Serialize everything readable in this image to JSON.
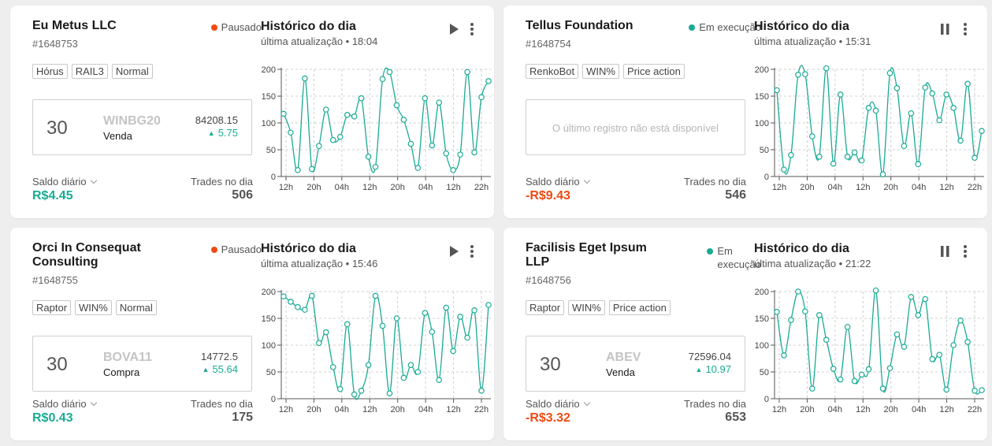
{
  "cards": [
    {
      "name_lines": [
        "Eu Metus LLC"
      ],
      "code": "#1648753",
      "status_lines": [
        "Pausado"
      ],
      "status_color": "#f04a14",
      "tags": [
        "Hórus",
        "RAIL3",
        "Normal"
      ],
      "order": {
        "qty": "30",
        "symbol": "WINBG20",
        "side": "Venda",
        "price": "84208.15",
        "change": "5.75"
      },
      "empty_text": "",
      "saldo_label": "Saldo diário",
      "saldo_value": "R$4.45",
      "saldo_sign": "pos",
      "trades_label": "Trades no dia",
      "trades_value": "506",
      "history_title": "Histórico do dia",
      "history_updated": "última atualização • 18:04",
      "action_icon": "play-icon"
    },
    {
      "name_lines": [
        "Tellus Foundation"
      ],
      "code": "#1648754",
      "status_lines": [
        "Em execução"
      ],
      "status_color": "#1aab95",
      "tags": [
        "RenkoBot",
        "WIN%",
        "Price action"
      ],
      "order": null,
      "empty_text": "O último registro não está disponível",
      "saldo_label": "Saldo diário",
      "saldo_value": "-R$9.43",
      "saldo_sign": "neg",
      "trades_label": "Trades no dia",
      "trades_value": "546",
      "history_title": "Histórico do dia",
      "history_updated": "última atualização • 15:31",
      "action_icon": "pause-icon"
    },
    {
      "name_lines": [
        "Orci In Consequat",
        "Consulting"
      ],
      "code": "#1648755",
      "status_lines": [
        "Pausado"
      ],
      "status_color": "#f04a14",
      "tags": [
        "Raptor",
        "WIN%",
        "Normal"
      ],
      "order": {
        "qty": "30",
        "symbol": "BOVA11",
        "side": "Compra",
        "price": "14772.5",
        "change": "55.64"
      },
      "empty_text": "",
      "saldo_label": "Saldo diário",
      "saldo_value": "R$0.43",
      "saldo_sign": "pos",
      "trades_label": "Trades no dia",
      "trades_value": "175",
      "history_title": "Histórico do dia",
      "history_updated": "última atualização • 15:46",
      "action_icon": "play-icon"
    },
    {
      "name_lines": [
        "Facilisis Eget Ipsum",
        "LLP"
      ],
      "code": "#1648756",
      "status_lines": [
        "Em",
        "execução"
      ],
      "status_color": "#1aab95",
      "tags": [
        "Raptor",
        "WIN%",
        "Price action"
      ],
      "order": {
        "qty": "30",
        "symbol": "ABEV",
        "side": "Venda",
        "price": "72596.04",
        "change": "10.97"
      },
      "empty_text": "",
      "saldo_label": "Saldo diário",
      "saldo_value": "-R$3.32",
      "saldo_sign": "neg",
      "trades_label": "Trades no dia",
      "trades_value": "653",
      "history_title": "Histórico do dia",
      "history_updated": "última atualização • 21:22",
      "action_icon": "pause-icon"
    }
  ],
  "chart_data": [
    {
      "type": "line",
      "xticks": [
        "12h",
        "20h",
        "04h",
        "12h",
        "20h",
        "04h",
        "12h",
        "22h"
      ],
      "yticks": [
        0,
        50,
        100,
        150,
        200
      ],
      "ylim": [
        0,
        200
      ],
      "grid": true,
      "color": "#1aab95",
      "values": [
        117,
        82,
        12,
        183,
        14,
        57,
        125,
        68,
        74,
        115,
        112,
        146,
        37,
        18,
        182,
        195,
        133,
        106,
        61,
        16,
        146,
        58,
        138,
        43,
        12,
        41,
        195,
        45,
        148,
        178
      ]
    },
    {
      "type": "line",
      "xticks": [
        "12h",
        "20h",
        "04h",
        "12h",
        "20h",
        "04h",
        "12h",
        "22h"
      ],
      "yticks": [
        0,
        50,
        100,
        150,
        200
      ],
      "ylim": [
        0,
        200
      ],
      "grid": true,
      "color": "#1aab95",
      "values": [
        161,
        13,
        40,
        190,
        191,
        75,
        37,
        202,
        24,
        153,
        37,
        45,
        30,
        128,
        123,
        4,
        193,
        165,
        57,
        118,
        23,
        166,
        155,
        105,
        153,
        128,
        67,
        173,
        35,
        85
      ]
    },
    {
      "type": "line",
      "xticks": [
        "12h",
        "20h",
        "04h",
        "12h",
        "20h",
        "04h",
        "12h",
        "22h"
      ],
      "yticks": [
        0,
        50,
        100,
        150,
        200
      ],
      "ylim": [
        0,
        200
      ],
      "grid": true,
      "color": "#1aab95",
      "values": [
        191,
        181,
        171,
        166,
        192,
        104,
        124,
        59,
        18,
        139,
        8,
        15,
        63,
        192,
        136,
        10,
        150,
        39,
        63,
        50,
        160,
        125,
        35,
        170,
        89,
        153,
        114,
        165,
        15,
        175
      ]
    },
    {
      "type": "line",
      "xticks": [
        "12h",
        "20h",
        "04h",
        "12h",
        "20h",
        "04h",
        "12h",
        "22h"
      ],
      "yticks": [
        0,
        50,
        100,
        150,
        200
      ],
      "ylim": [
        0,
        200
      ],
      "grid": true,
      "color": "#1aab95",
      "values": [
        162,
        81,
        147,
        200,
        163,
        19,
        156,
        110,
        56,
        36,
        134,
        33,
        45,
        55,
        202,
        19,
        57,
        120,
        97,
        190,
        156,
        186,
        74,
        82,
        17,
        100,
        146,
        106,
        15,
        16
      ]
    }
  ]
}
